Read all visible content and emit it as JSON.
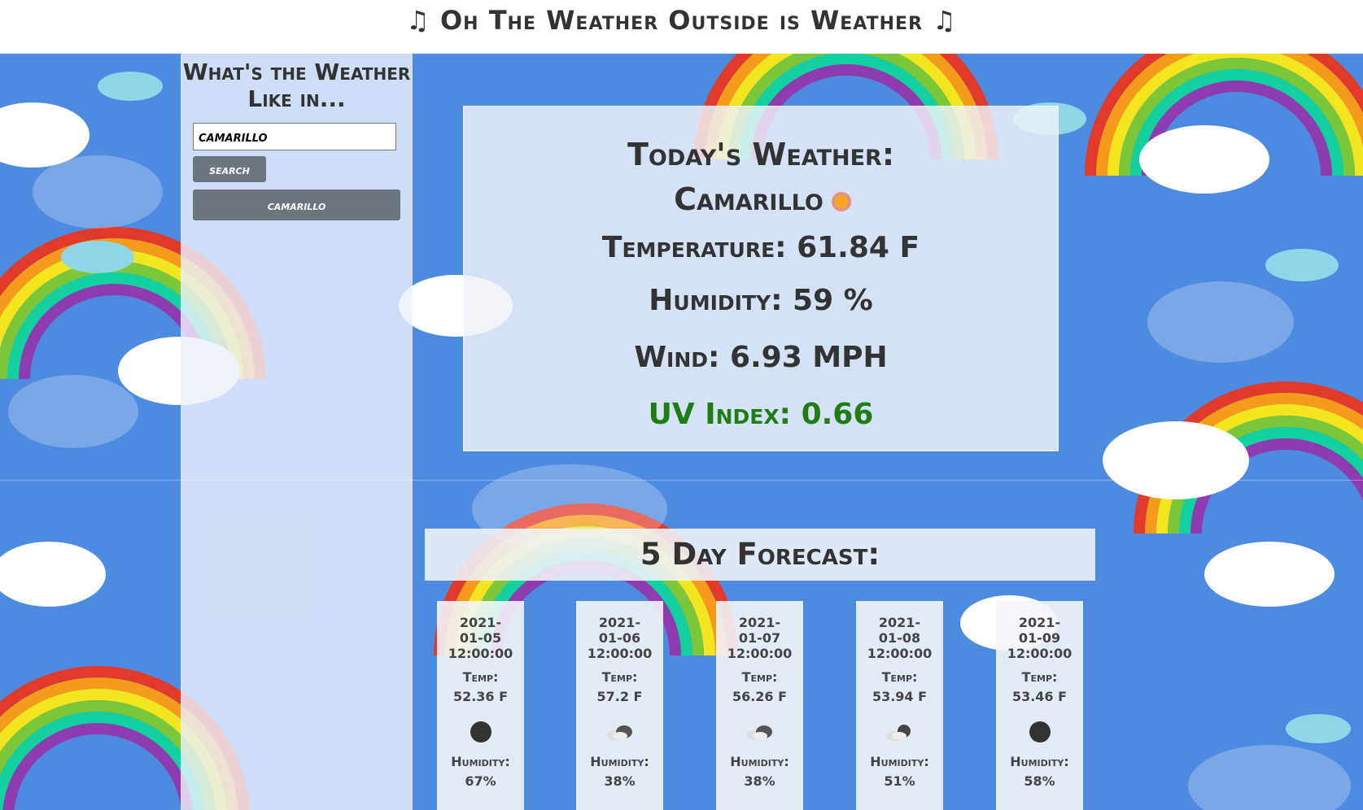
{
  "header": {
    "title": "♫ Oh The Weather Outside is Weather ♫"
  },
  "sidebar": {
    "heading": "What's the Weather Like in...",
    "search_value": "camarillo",
    "search_button": "search",
    "history": [
      "camarillo"
    ]
  },
  "today": {
    "heading": "Today's Weather:",
    "city": "Camarillo",
    "icon": "sun-icon",
    "temperature": "Temperature: 61.84 F",
    "humidity": "Humidity: 59 %",
    "wind": "Wind: 6.93 MPH",
    "uv": "UV Index: 0.66",
    "uv_color": "#1e7d14"
  },
  "forecast": {
    "title": "5 Day Forecast:",
    "temp_label": "Temp:",
    "humidity_label": "Humidity:",
    "days": [
      {
        "date_line1": "2021-",
        "date_line2": "01-05",
        "date_line3": "12:00:00",
        "temp": "52.36 F",
        "icon": "moon-icon",
        "humidity": "67%"
      },
      {
        "date_line1": "2021-",
        "date_line2": "01-06",
        "date_line3": "12:00:00",
        "temp": "57.2 F",
        "icon": "cloud-icon",
        "humidity": "38%"
      },
      {
        "date_line1": "2021-",
        "date_line2": "01-07",
        "date_line3": "12:00:00",
        "temp": "56.26 F",
        "icon": "cloud-icon",
        "humidity": "38%"
      },
      {
        "date_line1": "2021-",
        "date_line2": "01-08",
        "date_line3": "12:00:00",
        "temp": "53.94 F",
        "icon": "partly-cloudy-night-icon",
        "humidity": "51%"
      },
      {
        "date_line1": "2021-",
        "date_line2": "01-09",
        "date_line3": "12:00:00",
        "temp": "53.46 F",
        "icon": "moon-icon",
        "humidity": "58%"
      }
    ]
  },
  "colors": {
    "background": "#4d8be0",
    "button": "#6c757d"
  }
}
